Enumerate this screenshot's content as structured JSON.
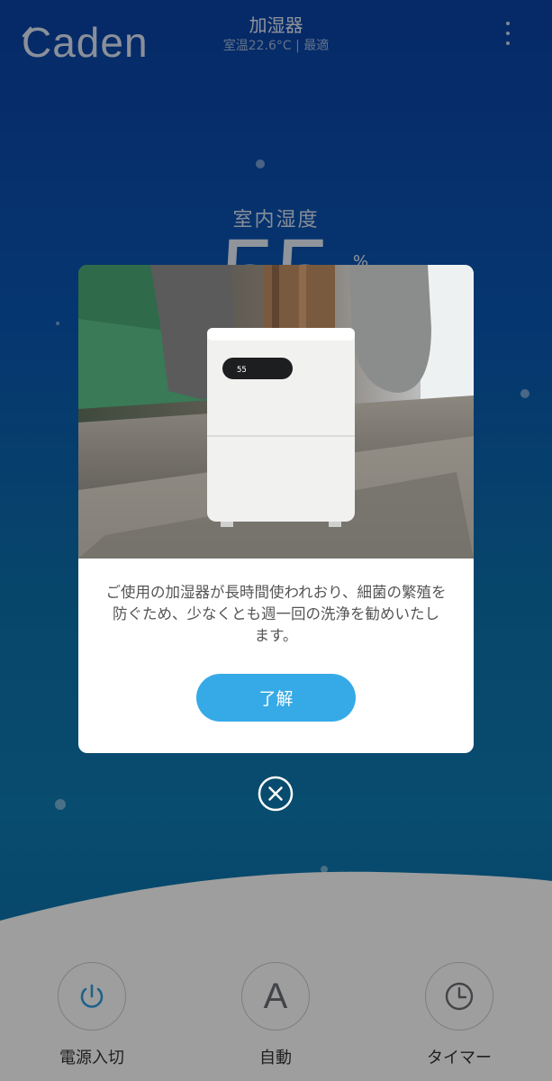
{
  "header": {
    "brand": "Caden",
    "title": "加湿器",
    "subtitle": "室温22.6°C | 最適"
  },
  "humidity": {
    "label": "室内湿度",
    "value": "55",
    "unit": "%"
  },
  "dialog": {
    "message": "ご使用の加湿器が長時間使われおり、細菌の繁殖を防ぐため、少なくとも週一回の洗浄を勧めいたします。",
    "ok_label": "了解",
    "device_display": "55"
  },
  "controls": [
    {
      "label": "電源入切",
      "icon": "power-icon"
    },
    {
      "label": "自動",
      "icon": "auto-icon",
      "letter": "A"
    },
    {
      "label": "タイマー",
      "icon": "clock-icon"
    }
  ],
  "colors": {
    "accent": "#36aae6",
    "background_top": "#0a43a8",
    "background_bottom": "#0d7bb3"
  }
}
